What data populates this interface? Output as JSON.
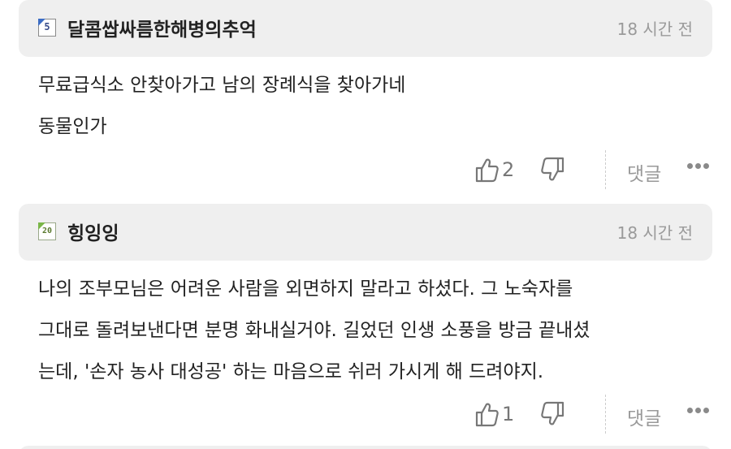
{
  "comments": [
    {
      "nickname": "달콤쌉싸름한해병의추억",
      "level": "5",
      "timestamp": "18 시간 전",
      "lines": [
        "무료급식소 안찾아가고 남의 장례식을 찾아가네",
        "동물인가"
      ],
      "likes": "2",
      "reply_label": "댓글"
    },
    {
      "nickname": "힝잉잉",
      "level": "20",
      "timestamp": "18 시간 전",
      "lines": [
        "나의 조부모님은 어려운 사람을 외면하지 말라고 하셨다. 그 노숙자를",
        "그대로 돌려보낸다면 분명 화내실거야. 길었던 인생 소풍을 방금 끝내셨",
        "는데, '손자 농사 대성공' 하는 마음으로 쉬러 가시게 해 드려야지."
      ],
      "likes": "1",
      "reply_label": "댓글"
    }
  ],
  "icons": {
    "like": "thumbs-up-icon",
    "dislike": "thumbs-down-icon",
    "more": "more-dots-icon"
  },
  "colors": {
    "header_bg": "#efefef",
    "timestamp": "#9a9a9a",
    "icon_gray": "#777777"
  }
}
